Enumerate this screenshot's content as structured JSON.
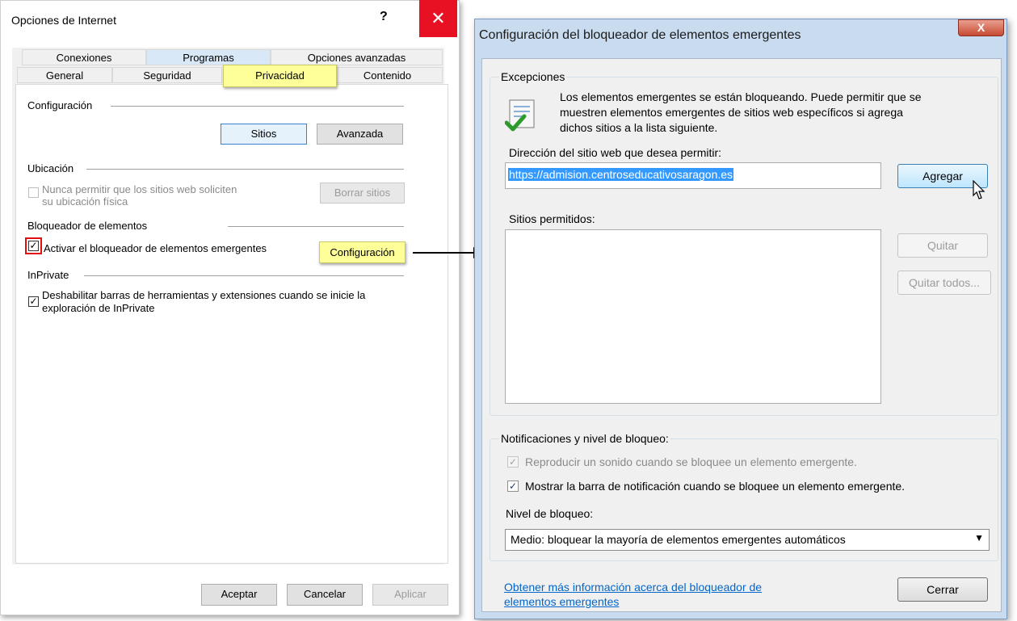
{
  "internet_options": {
    "title": "Opciones de Internet",
    "help_glyph": "?",
    "close_glyph": "✕",
    "tabs_row1": [
      "Conexiones",
      "Programas",
      "Opciones avanzadas"
    ],
    "tabs_row2": [
      "General",
      "Seguridad",
      "Privacidad",
      "Contenido"
    ],
    "config_section": "Configuración",
    "sites_button": "Sitios",
    "advanced_button": "Avanzada",
    "location_section": "Ubicación",
    "location_checkbox_line1": "Nunca permitir que los sitios web soliciten",
    "location_checkbox_line2": "su ubicación física",
    "clear_sites_button": "Borrar sitios",
    "popup_section": "Bloqueador de elementos",
    "popup_checkbox": "Activar el bloqueador de elementos emergentes",
    "popup_settings_button": "Configuración",
    "inprivate_section": "InPrivate",
    "inprivate_checkbox_line1": "Deshabilitar barras de herramientas y extensiones cuando se inicie la",
    "inprivate_checkbox_line2": "exploración de InPrivate",
    "ok_button": "Aceptar",
    "cancel_button": "Cancelar",
    "apply_button": "Aplicar"
  },
  "popup_blocker": {
    "title": "Configuración del bloqueador de elementos emergentes",
    "close_glyph": "X",
    "exceptions_group": "Excepciones",
    "info_line1": "Los elementos emergentes se están bloqueando. Puede permitir que se",
    "info_line2": "muestren elementos emergentes de sitios web específicos si agrega",
    "info_line3": "dichos sitios a la lista siguiente.",
    "address_label": "Dirección del sitio web que desea permitir:",
    "address_value": "https://admision.centroseducativosaragon.es",
    "add_button": "Agregar",
    "allowed_sites_label": "Sitios permitidos:",
    "remove_button": "Quitar",
    "remove_all_button": "Quitar todos...",
    "notifications_group": "Notificaciones y nivel de bloqueo:",
    "sound_checkbox": "Reproducir un sonido cuando se bloquee un elemento emergente.",
    "infobar_checkbox": "Mostrar la barra de notificación cuando se bloquee un elemento emergente.",
    "block_level_label": "Nivel de bloqueo:",
    "block_level_value": "Medio: bloquear la mayoría de elementos emergentes automáticos",
    "help_link_line1": "Obtener más información acerca del bloqueador de",
    "help_link_line2": "elementos emergentes",
    "close_button": "Cerrar"
  }
}
